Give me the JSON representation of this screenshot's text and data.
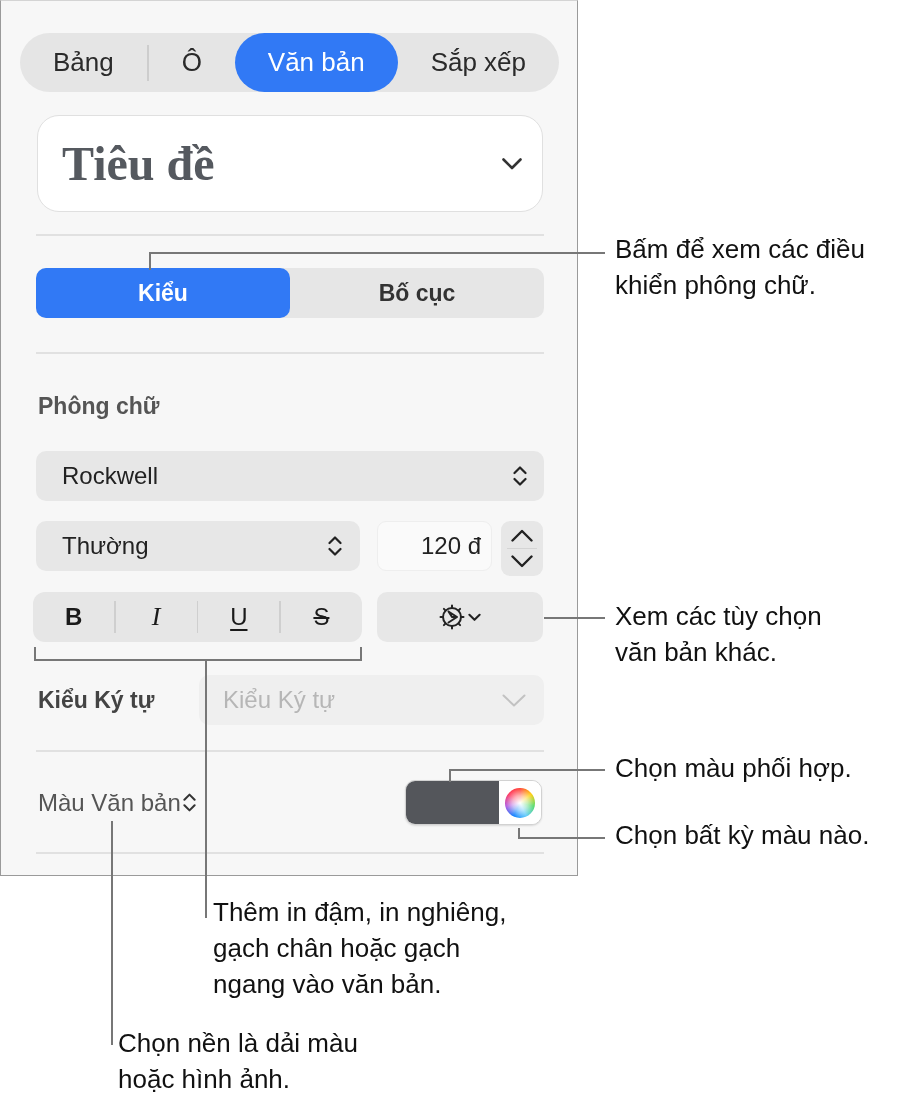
{
  "inspector_tabs": [
    {
      "label": "Bảng",
      "selected": false
    },
    {
      "label": "Ô",
      "selected": false
    },
    {
      "label": "Văn bản",
      "selected": true
    },
    {
      "label": "Sắp xếp",
      "selected": false
    }
  ],
  "paragraph_style": {
    "value": "Tiêu đề"
  },
  "section_tabs": [
    {
      "label": "Kiểu",
      "selected": true
    },
    {
      "label": "Bố cục",
      "selected": false
    }
  ],
  "font": {
    "heading": "Phông chữ",
    "family": "Rockwell",
    "typeface": "Thường",
    "size": "120 đ",
    "format_buttons": [
      {
        "label": "B",
        "kind": "bold"
      },
      {
        "label": "I",
        "kind": "italic"
      },
      {
        "label": "U",
        "kind": "underline"
      },
      {
        "label": "S",
        "kind": "strikethrough"
      }
    ]
  },
  "character_style": {
    "label": "Kiểu Ký tự",
    "value": "Kiểu Ký tự",
    "disabled": true
  },
  "text_color": {
    "label": "Màu Văn bản",
    "color": "#54565b"
  },
  "callouts": [
    {
      "text": "Bấm để xem các điều khiển phông chữ."
    },
    {
      "text": "Xem các tùy chọn văn bản khác."
    },
    {
      "text": "Chọn màu phối hợp."
    },
    {
      "text": "Chọn bất kỳ màu nào."
    },
    {
      "text": "Thêm in đậm, in nghiêng, gạch chân hoặc gạch ngang vào văn bản."
    },
    {
      "text": "Chọn nền là dải màu hoặc hình ảnh."
    }
  ]
}
